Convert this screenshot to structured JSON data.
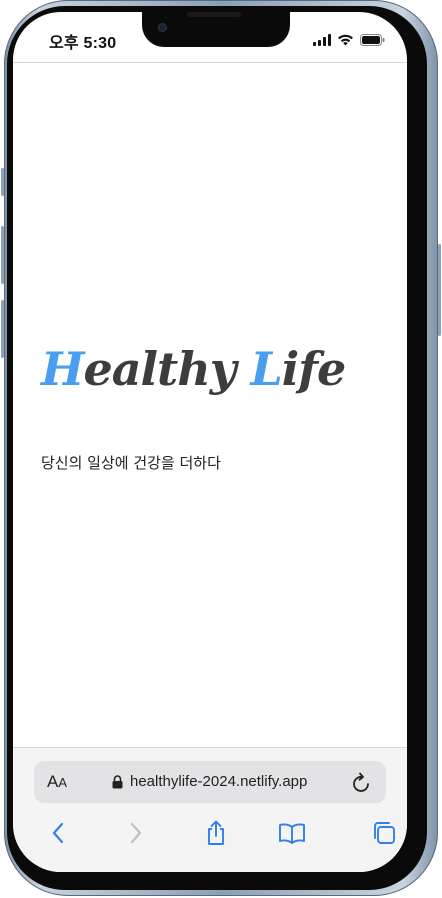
{
  "status_bar": {
    "time": "오후 5:30",
    "icons": [
      "cellular-signal-icon",
      "wifi-icon",
      "battery-icon"
    ]
  },
  "page": {
    "logo": {
      "first_letter": "H",
      "part1": "ealthy ",
      "second_letter": "L",
      "part2": "ife",
      "accent_color": "#4a9ef0",
      "text_color": "#3d3d3d"
    },
    "tagline": "당신의 일상에 건강을 더하다"
  },
  "browser": {
    "text_size_label": "A",
    "text_size_label_small": "A",
    "url": "healthylife-2024.netlify.app",
    "icons": {
      "lock": "lock-icon",
      "reload": "reload-icon",
      "back": "back-chevron-icon",
      "forward": "forward-chevron-icon",
      "share": "share-icon",
      "bookmarks": "bookmarks-icon",
      "tabs": "tabs-icon"
    },
    "accent_color": "#2f80ed",
    "disabled_color": "#b9c3cc"
  }
}
